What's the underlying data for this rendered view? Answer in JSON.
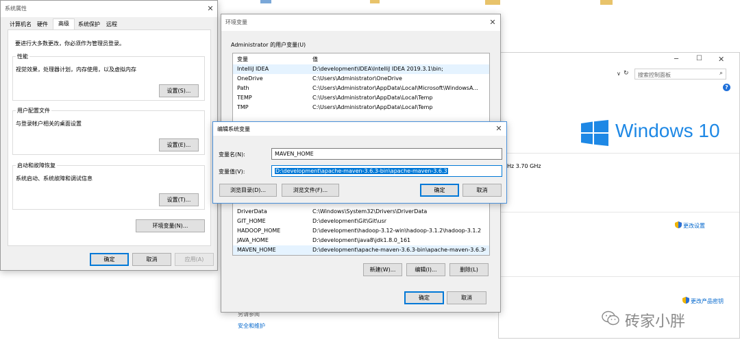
{
  "system_props": {
    "title": "系统属性",
    "tabs": [
      "计算机名",
      "硬件",
      "高级",
      "系统保护",
      "远程"
    ],
    "notice": "要进行大多数更改，你必须作为管理员登录。",
    "perf": {
      "label": "性能",
      "desc": "视觉效果，处理器计划，内存使用，以及虚拟内存",
      "btn": "设置(S)..."
    },
    "profile": {
      "label": "用户配置文件",
      "desc": "与登录帐户相关的桌面设置",
      "btn": "设置(E)..."
    },
    "startup": {
      "label": "启动和故障恢复",
      "desc": "系统启动、系统故障和调试信息",
      "btn": "设置(T)..."
    },
    "env_btn": "环境变量(N)...",
    "ok": "确定",
    "cancel": "取消",
    "apply": "应用(A)"
  },
  "env_vars": {
    "title": "环境变量",
    "user_section": "Administrator 的用户变量(U)",
    "col_var": "变量",
    "col_val": "值",
    "user_rows": [
      {
        "name": "IntelliJ IDEA",
        "value": "D:\\development\\IDEA\\IntelliJ IDEA 2019.3.1\\bin;"
      },
      {
        "name": "OneDrive",
        "value": "C:\\Users\\Administrator\\OneDrive"
      },
      {
        "name": "Path",
        "value": "C:\\Users\\Administrator\\AppData\\Local\\Microsoft\\WindowsA..."
      },
      {
        "name": "TEMP",
        "value": "C:\\Users\\Administrator\\AppData\\Local\\Temp"
      },
      {
        "name": "TMP",
        "value": "C:\\Users\\Administrator\\AppData\\Local\\Temp"
      }
    ],
    "sys_rows": [
      {
        "name": "DriverData",
        "value": "C:\\Windows\\System32\\Drivers\\DriverData"
      },
      {
        "name": "GIT_HOME",
        "value": "D:\\development\\Git\\Git\\usr"
      },
      {
        "name": "HADOOP_HOME",
        "value": "D:\\development\\hadoop-3.12-win\\hadoop-3.1.2\\hadoop-3.1.2"
      },
      {
        "name": "JAVA_HOME",
        "value": "D:\\development\\java8\\jdk1.8.0_161"
      },
      {
        "name": "MAVEN_HOME",
        "value": "D:\\development\\apache-maven-3.6.3-bin\\apache-maven-3.6.3"
      }
    ],
    "new_btn": "新建(W)...",
    "edit_btn": "编辑(I)...",
    "delete_btn": "删除(L)",
    "ok": "确定",
    "cancel": "取消"
  },
  "edit_dialog": {
    "title": "编辑系统变量",
    "name_label": "变量名(N):",
    "value_label": "变量值(V):",
    "name_value": "MAVEN_HOME",
    "value_value": "D:\\development\\apache-maven-3.6.3-bin\\apache-maven-3.6.3",
    "browse_dir": "浏览目录(D)...",
    "browse_file": "浏览文件(F)...",
    "ok": "确定",
    "cancel": "取消"
  },
  "control_panel": {
    "search_placeholder": "搜索控制面板",
    "windows_logo_text": "Windows 10",
    "cpu_speed": "Hz   3.70 GHz",
    "change_settings": "更改设置",
    "change_key": "更改产品密钥",
    "see_also": "另请参阅",
    "security": "安全和维护"
  },
  "watermark": "砖家小胖",
  "colors": {
    "accent": "#0078d7",
    "link": "#0066cc",
    "win_blue": "#1e88e5"
  }
}
